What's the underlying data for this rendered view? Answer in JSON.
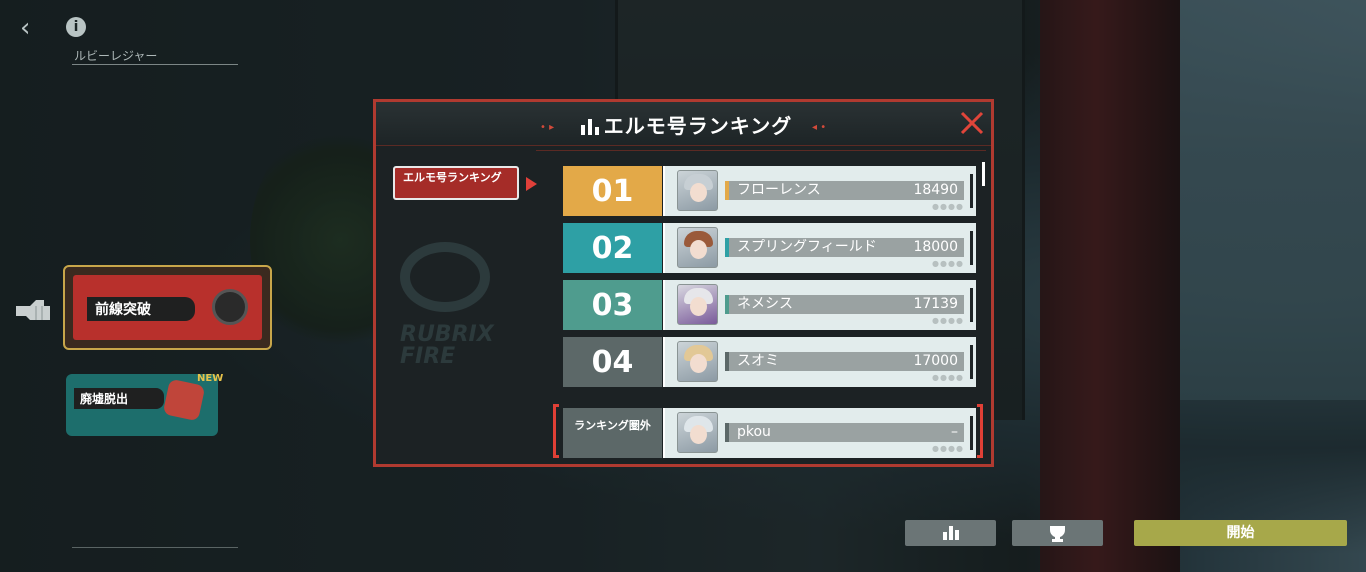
{
  "header": {
    "back_icon": "chevron-left-icon",
    "info_icon": "info-icon",
    "location_label": "ルビーレジャー"
  },
  "games": [
    {
      "title": "前線突破",
      "selected": true,
      "badge": ""
    },
    {
      "title": "廃墟脱出",
      "selected": false,
      "badge": "NEW"
    }
  ],
  "modal": {
    "title": "エルモ号ランキング",
    "close_icon": "close-x-icon",
    "side_tab_label": "エルモ号ランキング",
    "accent_color": "#b03a30"
  },
  "ranking": {
    "entries": [
      {
        "rank": "01",
        "name": "フローレンス",
        "score": "18490",
        "rank_color": "#e3a948",
        "bar_color": "#e3a948"
      },
      {
        "rank": "02",
        "name": "スプリングフィールド",
        "score": "18000",
        "rank_color": "#2ea0a5",
        "bar_color": "#2ea0a5"
      },
      {
        "rank": "03",
        "name": "ネメシス",
        "score": "17139",
        "rank_color": "#4f9c8e",
        "bar_color": "#4f9c8e"
      },
      {
        "rank": "04",
        "name": "スオミ",
        "score": "17000",
        "rank_color": "#5c6868",
        "bar_color": "#5c6868"
      }
    ],
    "self": {
      "rank": "ランキング圏外",
      "name": "pkou",
      "score": "–"
    }
  },
  "footer": {
    "ranking_icon": "bar-chart-icon",
    "trophy_icon": "trophy-icon",
    "start_label": "開始"
  }
}
